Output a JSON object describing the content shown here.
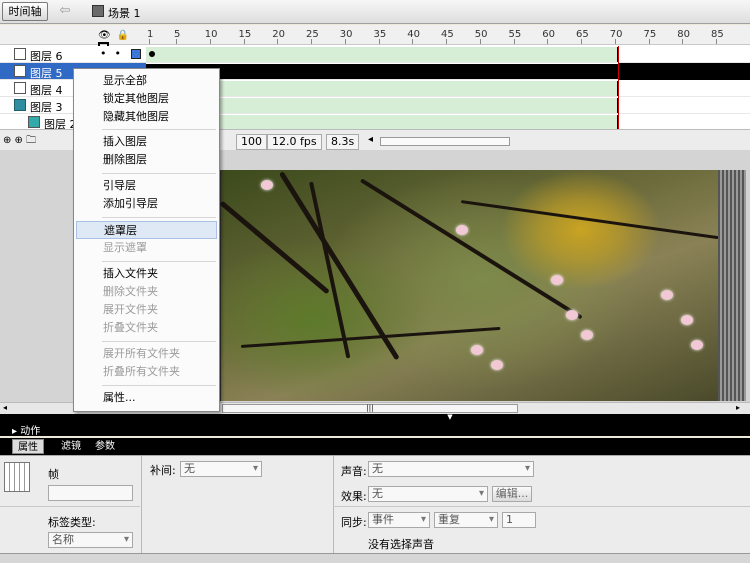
{
  "topbar": {
    "timeline_button": "时间轴",
    "scene_label": "场景 1"
  },
  "timeline": {
    "ruler_numbers": [
      "1",
      "5",
      "10",
      "15",
      "20",
      "25",
      "30",
      "35",
      "40",
      "45",
      "50",
      "55",
      "60",
      "65",
      "70",
      "75",
      "80",
      "85"
    ],
    "layers": [
      {
        "name": "图层 6",
        "icon": "layer-icon",
        "selected": false
      },
      {
        "name": "图层 5",
        "icon": "layer-icon",
        "selected": true
      },
      {
        "name": "图层 4",
        "icon": "layer-icon",
        "selected": false
      },
      {
        "name": "图层 3",
        "icon": "mask-layer-icon",
        "selected": false
      },
      {
        "name": "图层 2",
        "icon": "masked-layer-icon",
        "selected": false
      }
    ],
    "zoom": "100",
    "fps": "12.0 fps",
    "time": "8.3s"
  },
  "context_menu": {
    "items": [
      {
        "label": "显示全部",
        "enabled": true
      },
      {
        "label": "锁定其他图层",
        "enabled": true
      },
      {
        "label": "隐藏其他图层",
        "enabled": true
      },
      {
        "label": "插入图层",
        "enabled": true
      },
      {
        "label": "删除图层",
        "enabled": true
      },
      {
        "label": "引导层",
        "enabled": true
      },
      {
        "label": "添加引导层",
        "enabled": true
      },
      {
        "label": "遮罩层",
        "enabled": true,
        "highlighted": true
      },
      {
        "label": "显示遮罩",
        "enabled": false
      },
      {
        "label": "插入文件夹",
        "enabled": true
      },
      {
        "label": "删除文件夹",
        "enabled": false
      },
      {
        "label": "展开文件夹",
        "enabled": false
      },
      {
        "label": "折叠文件夹",
        "enabled": false
      },
      {
        "label": "展开所有文件夹",
        "enabled": false
      },
      {
        "label": "折叠所有文件夹",
        "enabled": false
      },
      {
        "label": "属性...",
        "enabled": true
      }
    ]
  },
  "panels": {
    "actions_label": "动作",
    "tabs": [
      "属性",
      "滤镜",
      "参数"
    ],
    "props": {
      "frame_label": "帧",
      "tween_label": "补间:",
      "tween_value": "无",
      "label_type_label": "标签类型:",
      "label_type_value": "名称",
      "sound_label": "声音:",
      "sound_value": "无",
      "effect_label": "效果:",
      "effect_value": "无",
      "edit_button": "编辑...",
      "sync_label": "同步:",
      "sync_value": "事件",
      "repeat_value": "重复",
      "repeat_count": "1",
      "no_sound_text": "没有选择声音"
    }
  }
}
